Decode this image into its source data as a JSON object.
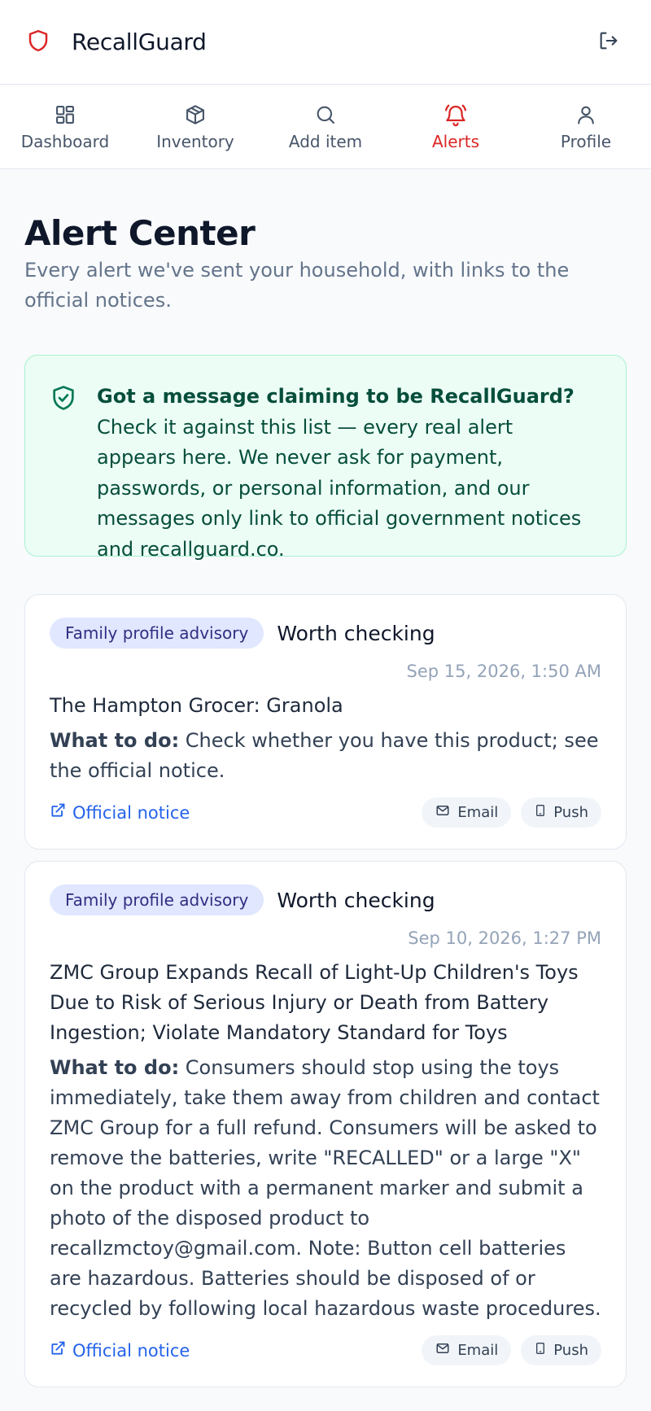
{
  "app": {
    "name": "RecallGuard"
  },
  "nav": {
    "items": [
      {
        "label": "Dashboard"
      },
      {
        "label": "Inventory"
      },
      {
        "label": "Add item"
      },
      {
        "label": "Alerts"
      },
      {
        "label": "Profile"
      }
    ],
    "active": "Alerts"
  },
  "page": {
    "title": "Alert Center",
    "subtitle": "Every alert we've sent your household, with links to the official notices."
  },
  "notice": {
    "bold": "Got a message claiming to be RecallGuard?",
    "text": " Check it against this list — every real alert appears here. We never ask for payment, passwords, or personal information, and our messages only link to official government notices and recallguard.co."
  },
  "alerts": [
    {
      "tag": "Family profile advisory",
      "severity": "Worth checking",
      "date": "Sep 15, 2026, 1:50 AM",
      "title": "The Hampton Grocer: Granola",
      "action_label": "What to do:",
      "action": " Check whether you have this product; see the official notice.",
      "link": "Official notice",
      "channels": [
        "Email",
        "Push"
      ]
    },
    {
      "tag": "Family profile advisory",
      "severity": "Worth checking",
      "date": "Sep 10, 2026, 1:27 PM",
      "title": "ZMC Group Expands Recall of Light-Up Children's Toys Due to Risk of Serious Injury or Death from Battery Ingestion; Violate Mandatory Standard for Toys",
      "action_label": "What to do:",
      "action": " Consumers should stop using the toys immediately, take them away from children and contact ZMC Group for a full refund. Consumers will be asked to remove the batteries, write \"RECALLED\" or a large \"X\" on the product with a permanent marker and submit a photo of the disposed product to recallzmctoy@gmail.com. Note: Button cell batteries are hazardous. Batteries should be disposed of or recycled by following local hazardous waste procedures.",
      "link": "Official notice",
      "channels": [
        "Email",
        "Push"
      ]
    }
  ],
  "colors": {
    "brand": "#dc2626",
    "link": "#2563eb",
    "notice_bg": "#ecfdf5",
    "tag_bg": "#e0e7ff"
  },
  "icons": {
    "logo": "shield-icon",
    "logout": "logout-icon",
    "nav": [
      "grid-icon",
      "box-icon",
      "search-icon",
      "bell-icon",
      "user-icon"
    ],
    "notice": "shield-check-icon",
    "link": "external-link-icon",
    "channels": [
      "mail-icon",
      "phone-icon"
    ]
  }
}
